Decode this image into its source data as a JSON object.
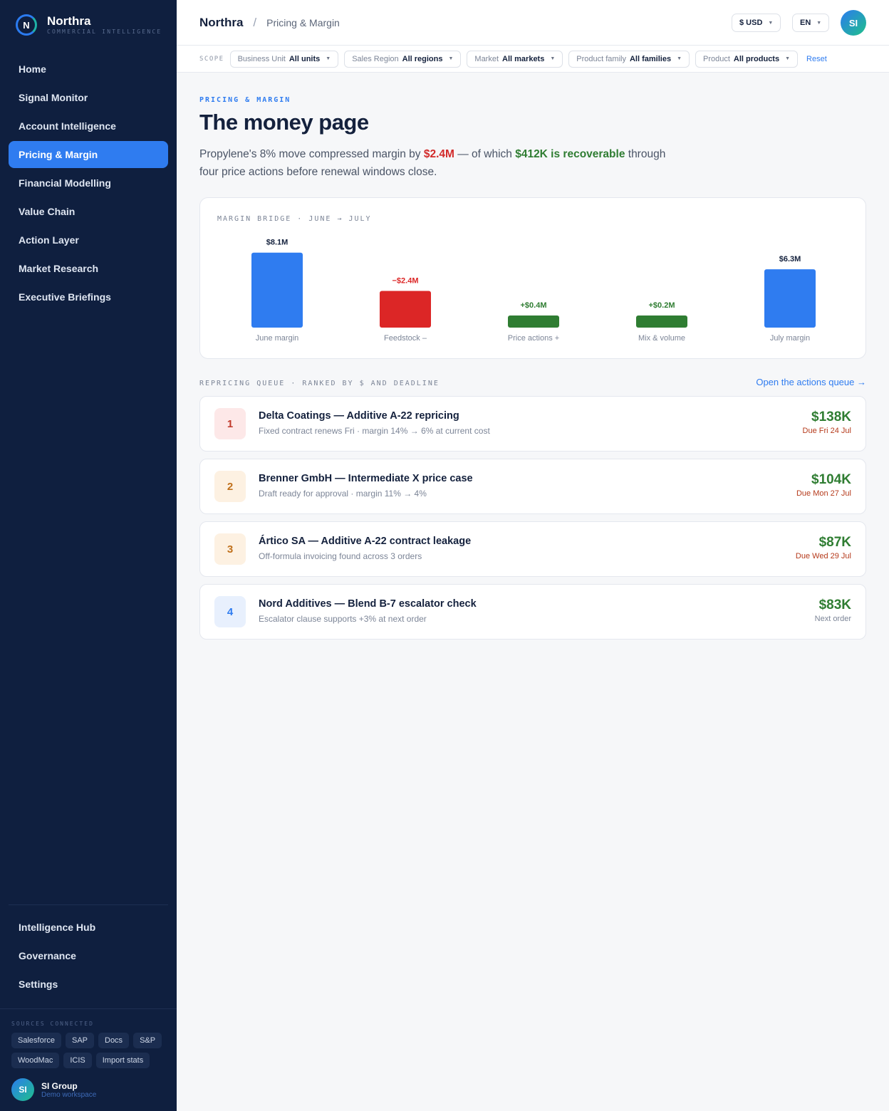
{
  "brand": {
    "name": "Northra",
    "tagline": "COMMERCIAL INTELLIGENCE",
    "logo_letter": "N"
  },
  "nav": {
    "items": [
      {
        "label": "Home"
      },
      {
        "label": "Signal Monitor"
      },
      {
        "label": "Account Intelligence"
      },
      {
        "label": "Pricing & Margin",
        "active": true
      },
      {
        "label": "Financial Modelling"
      },
      {
        "label": "Value Chain"
      },
      {
        "label": "Action Layer"
      },
      {
        "label": "Market Research"
      },
      {
        "label": "Executive Briefings"
      }
    ],
    "bottom": [
      {
        "label": "Intelligence Hub"
      },
      {
        "label": "Governance"
      },
      {
        "label": "Settings"
      }
    ]
  },
  "sources": {
    "label": "SOURCES CONNECTED",
    "chips": [
      "Salesforce",
      "SAP",
      "Docs",
      "S&P",
      "WoodMac",
      "ICIS",
      "Import stats"
    ]
  },
  "workspace": {
    "initials": "SI",
    "name": "SI Group",
    "sub": "Demo workspace"
  },
  "header": {
    "crumb_root": "Northra",
    "crumb_sep": "/",
    "crumb_page": "Pricing & Margin",
    "currency": "$ USD",
    "language": "EN",
    "avatar": "SI"
  },
  "scope": {
    "label": "SCOPE",
    "filters": [
      {
        "key": "Business Unit",
        "value": "All units"
      },
      {
        "key": "Sales Region",
        "value": "All regions"
      },
      {
        "key": "Market",
        "value": "All markets"
      },
      {
        "key": "Product family",
        "value": "All families"
      },
      {
        "key": "Product",
        "value": "All products"
      }
    ],
    "reset": "Reset"
  },
  "main": {
    "eyebrow": "PRICING & MARGIN",
    "title": "The money page",
    "lede": {
      "p1": "Propylene's 8% move compressed margin by ",
      "amount": "$2.4M",
      "p2": " — of which ",
      "recoverable": "$412K is recoverable",
      "p3": " through four price actions before renewal windows close."
    }
  },
  "chart_data": {
    "type": "bar",
    "title": "MARGIN BRIDGE · JUNE → JULY",
    "categories": [
      "June margin",
      "Feedstock –",
      "Price actions +",
      "Mix & volume",
      "July margin"
    ],
    "values": [
      8.1,
      -2.4,
      0.4,
      0.2,
      6.3
    ],
    "value_labels": [
      "$8.1M",
      "−$2.4M",
      "+$0.4M",
      "+$0.2M",
      "$6.3M"
    ],
    "kinds": [
      "total",
      "decrease",
      "increase",
      "increase",
      "total"
    ],
    "colors": {
      "total": "#2f7cf0",
      "decrease": "#dc2626",
      "increase": "#2f7d32"
    },
    "unit": "$M"
  },
  "queue": {
    "label": "REPRICING QUEUE · RANKED BY $ AND DEADLINE",
    "link": "Open the actions queue →",
    "items": [
      {
        "rank": "1",
        "title": "Delta Coatings — Additive A-22 repricing",
        "sub": "Fixed contract renews Fri · margin 14% → 6% at current cost",
        "amount": "$138K",
        "due": "Due Fri 24 Jul"
      },
      {
        "rank": "2",
        "title": "Brenner GmbH — Intermediate X price case",
        "sub": "Draft ready for approval · margin 11% → 4%",
        "amount": "$104K",
        "due": "Due Mon 27 Jul"
      },
      {
        "rank": "3",
        "title": "Ártico SA — Additive A-22 contract leakage",
        "sub": "Off-formula invoicing found across 3 orders",
        "amount": "$87K",
        "due": "Due Wed 29 Jul"
      },
      {
        "rank": "4",
        "title": "Nord Additives — Blend B-7 escalator check",
        "sub": "Escalator clause supports +3% at next order",
        "amount": "$83K",
        "due": "Next order"
      }
    ]
  }
}
